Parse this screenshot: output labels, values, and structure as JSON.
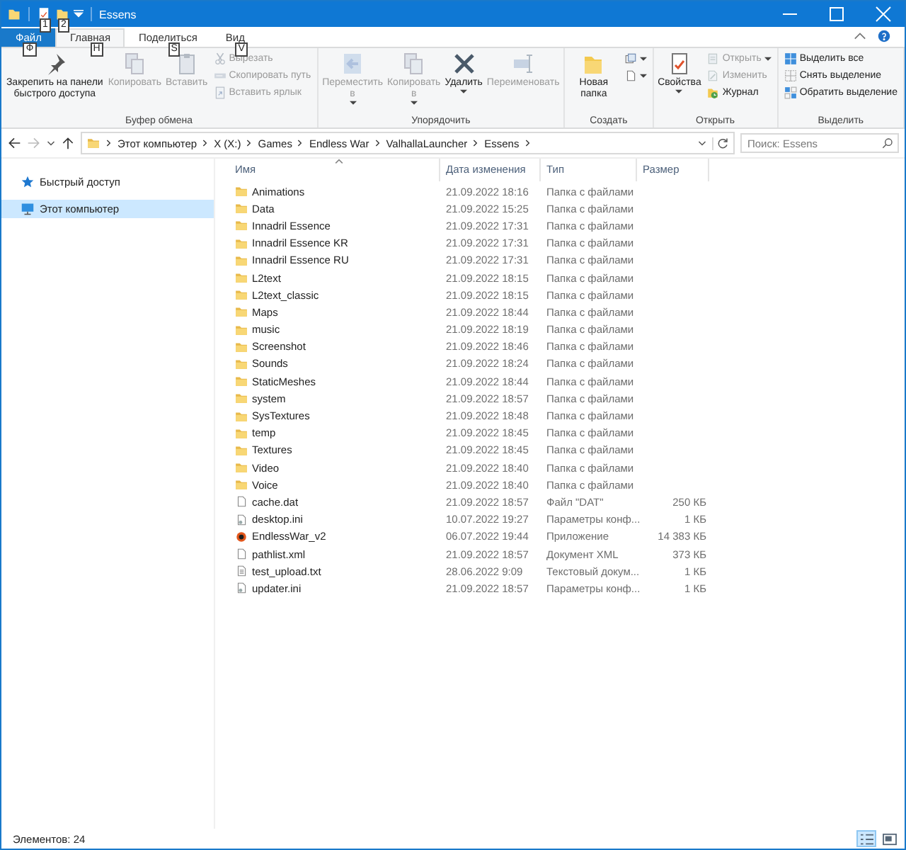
{
  "window": {
    "title": "Essens"
  },
  "quick_access_keytips": [
    "1",
    "2"
  ],
  "ribbon_tabs": [
    {
      "label": "Файл",
      "kind": "file",
      "keytip": "Ф",
      "selected": false
    },
    {
      "label": "Главная",
      "kind": "tab",
      "keytip": "H",
      "selected": true
    },
    {
      "label": "Поделиться",
      "kind": "tab",
      "keytip": "S",
      "selected": false
    },
    {
      "label": "Вид",
      "kind": "tab",
      "keytip": "V",
      "selected": false
    }
  ],
  "ribbon_groups": [
    {
      "label": "Буфер обмена",
      "large": [
        {
          "label": "Закрепить на панели быстрого доступа",
          "kind": "pin",
          "disabled": false
        },
        {
          "label": "Копировать",
          "kind": "copy",
          "disabled": true
        },
        {
          "label": "Вставить",
          "kind": "paste",
          "disabled": true
        }
      ],
      "small": [
        {
          "label": "Вырезать",
          "kind": "cut",
          "disabled": true
        },
        {
          "label": "Скопировать путь",
          "kind": "path",
          "disabled": true
        },
        {
          "label": "Вставить ярлык",
          "kind": "shortcut",
          "disabled": true
        }
      ]
    },
    {
      "label": "Упорядочить",
      "large": [
        {
          "label": "Переместить в",
          "kind": "move",
          "disabled": true,
          "dropdown": true
        },
        {
          "label": "Копировать в",
          "kind": "copyto",
          "disabled": true,
          "dropdown": true
        },
        {
          "label": "Удалить",
          "kind": "delete",
          "disabled": false,
          "dropdown": true
        },
        {
          "label": "Переименовать",
          "kind": "rename",
          "disabled": true
        }
      ]
    },
    {
      "label": "Создать",
      "large": [
        {
          "label": "Новая папка",
          "kind": "folder",
          "disabled": false
        }
      ],
      "small": [
        {
          "kind": "newitem",
          "disabled": false,
          "dropdown": true
        },
        {
          "kind": "easy",
          "disabled": false,
          "dropdown": true
        }
      ]
    },
    {
      "label": "Открыть",
      "large": [
        {
          "label": "Свойства",
          "kind": "props",
          "disabled": false,
          "dropdown": true
        }
      ],
      "small": [
        {
          "label": "Открыть",
          "kind": "open",
          "disabled": true,
          "dropdown": true
        },
        {
          "label": "Изменить",
          "kind": "edit",
          "disabled": true
        },
        {
          "label": "Журнал",
          "kind": "history",
          "disabled": false
        }
      ]
    },
    {
      "label": "Выделить",
      "small": [
        {
          "label": "Выделить все",
          "kind": "selall",
          "disabled": false
        },
        {
          "label": "Снять выделение",
          "kind": "selnone",
          "disabled": false
        },
        {
          "label": "Обратить выделение",
          "kind": "selinv",
          "disabled": false
        }
      ]
    }
  ],
  "address": {
    "path": [
      "Этот компьютер",
      "X (X:)",
      "Games",
      "Endless War",
      "ValhallaLauncher",
      "Essens"
    ]
  },
  "search": {
    "placeholder": "Поиск: Essens"
  },
  "sidebar": {
    "items": [
      {
        "label": "Быстрый доступ",
        "kind": "star",
        "selected": false
      },
      {
        "label": "Этот компьютер",
        "kind": "pc",
        "selected": true
      }
    ]
  },
  "table": {
    "columns": [
      {
        "label": "Имя",
        "sorted": true
      },
      {
        "label": "Дата изменения",
        "sorted": false
      },
      {
        "label": "Тип",
        "sorted": false
      },
      {
        "label": "Размер",
        "sorted": false
      }
    ],
    "rows": [
      {
        "name": "Animations",
        "kind": "folder",
        "date": "21.09.2022 18:16",
        "type": "Папка с файлами"
      },
      {
        "name": "Data",
        "kind": "folder",
        "date": "21.09.2022 15:25",
        "type": "Папка с файлами"
      },
      {
        "name": "Innadril Essence",
        "kind": "folder",
        "date": "21.09.2022 17:31",
        "type": "Папка с файлами"
      },
      {
        "name": "Innadril Essence KR",
        "kind": "folder",
        "date": "21.09.2022 17:31",
        "type": "Папка с файлами"
      },
      {
        "name": "Innadril Essence RU",
        "kind": "folder",
        "date": "21.09.2022 17:31",
        "type": "Папка с файлами"
      },
      {
        "name": "L2text",
        "kind": "folder",
        "date": "21.09.2022 18:15",
        "type": "Папка с файлами"
      },
      {
        "name": "L2text_classic",
        "kind": "folder",
        "date": "21.09.2022 18:15",
        "type": "Папка с файлами"
      },
      {
        "name": "Maps",
        "kind": "folder",
        "date": "21.09.2022 18:44",
        "type": "Папка с файлами"
      },
      {
        "name": "music",
        "kind": "folder",
        "date": "21.09.2022 18:19",
        "type": "Папка с файлами"
      },
      {
        "name": "Screenshot",
        "kind": "folder",
        "date": "21.09.2022 18:46",
        "type": "Папка с файлами"
      },
      {
        "name": "Sounds",
        "kind": "folder",
        "date": "21.09.2022 18:24",
        "type": "Папка с файлами"
      },
      {
        "name": "StaticMeshes",
        "kind": "folder",
        "date": "21.09.2022 18:44",
        "type": "Папка с файлами"
      },
      {
        "name": "system",
        "kind": "folder",
        "date": "21.09.2022 18:57",
        "type": "Папка с файлами"
      },
      {
        "name": "SysTextures",
        "kind": "folder",
        "date": "21.09.2022 18:48",
        "type": "Папка с файлами"
      },
      {
        "name": "temp",
        "kind": "folder",
        "date": "21.09.2022 18:45",
        "type": "Папка с файлами"
      },
      {
        "name": "Textures",
        "kind": "folder",
        "date": "21.09.2022 18:45",
        "type": "Папка с файлами"
      },
      {
        "name": "Video",
        "kind": "folder",
        "date": "21.09.2022 18:40",
        "type": "Папка с файлами"
      },
      {
        "name": "Voice",
        "kind": "folder",
        "date": "21.09.2022 18:40",
        "type": "Папка с файлами"
      },
      {
        "name": "cache.dat",
        "kind": "file",
        "date": "21.09.2022 18:57",
        "type": "Файл \"DAT\"",
        "size": "250 КБ"
      },
      {
        "name": "desktop.ini",
        "kind": "settings",
        "date": "10.07.2022 19:27",
        "type": "Параметры конф...",
        "size": "1 КБ"
      },
      {
        "name": "EndlessWar_v2",
        "kind": "app",
        "date": "06.07.2022 19:44",
        "type": "Приложение",
        "size": "14 383 КБ"
      },
      {
        "name": "pathlist.xml",
        "kind": "file",
        "date": "21.09.2022 18:57",
        "type": "Документ XML",
        "size": "373 КБ"
      },
      {
        "name": "test_upload.txt",
        "kind": "text",
        "date": "28.06.2022 9:09",
        "type": "Текстовый докум...",
        "size": "1 КБ"
      },
      {
        "name": "updater.ini",
        "kind": "settings",
        "date": "21.09.2022 18:57",
        "type": "Параметры конф...",
        "size": "1 КБ"
      }
    ]
  },
  "status_bar": {
    "count": "Элементов: 24",
    "views": [
      {
        "kind": "details",
        "selected": true
      },
      {
        "kind": "large",
        "selected": false
      }
    ]
  }
}
